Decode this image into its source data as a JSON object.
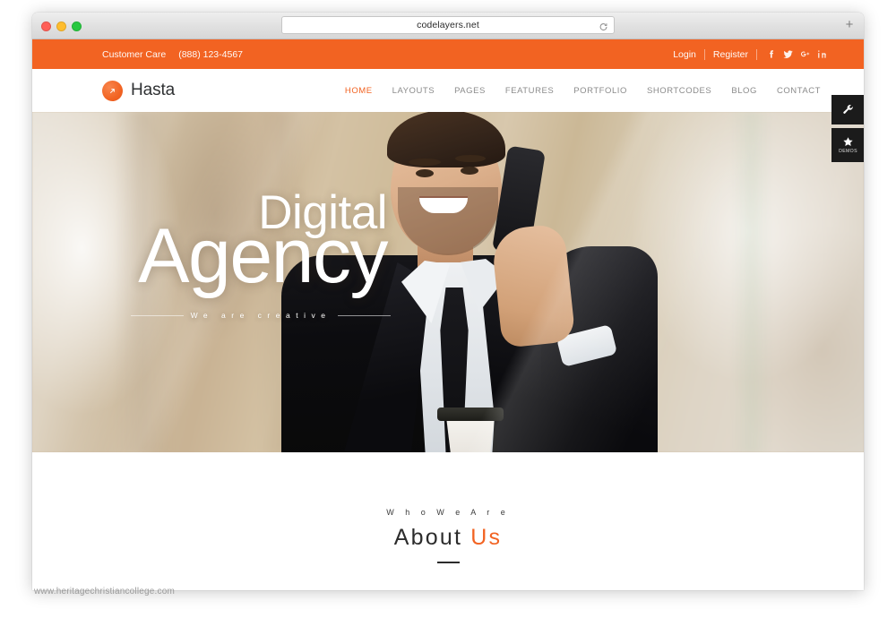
{
  "browser": {
    "url": "codelayers.net",
    "reload_icon": "reload-icon",
    "newtab_label": "+",
    "traffic_lights": [
      "close-red",
      "minimize-yellow",
      "maximize-green"
    ]
  },
  "topbar": {
    "care_label": "Customer Care",
    "phone": "(888) 123-4567",
    "login": "Login",
    "register": "Register",
    "socials": [
      {
        "name": "facebook-icon",
        "glyph": "f"
      },
      {
        "name": "twitter-icon",
        "glyph": "t"
      },
      {
        "name": "google-plus-icon",
        "glyph": "g+"
      },
      {
        "name": "linkedin-icon",
        "glyph": "in"
      }
    ]
  },
  "header": {
    "logo_text": "Hasta",
    "logo_icon": "arrow-circle-icon",
    "nav": [
      {
        "label": "HOME",
        "active": true
      },
      {
        "label": "LAYOUTS",
        "active": false
      },
      {
        "label": "PAGES",
        "active": false
      },
      {
        "label": "FEATURES",
        "active": false
      },
      {
        "label": "PORTFOLIO",
        "active": false
      },
      {
        "label": "SHORTCODES",
        "active": false
      },
      {
        "label": "BLOG",
        "active": false
      },
      {
        "label": "CONTACT",
        "active": false
      }
    ]
  },
  "sidetabs": {
    "settings_icon": "wrench-icon",
    "demos_icon": "star-icon",
    "demos_label": "DEMOS"
  },
  "hero": {
    "line1": "Digital",
    "line2": "Agency",
    "tagline": "We are creative"
  },
  "about": {
    "kicker": "W h o   W e   A r e",
    "title_dark": "About",
    "title_accent": "Us"
  },
  "watermark": "www.heritagechristiancollege.com",
  "colors": {
    "accent": "#f26322",
    "nav_text": "#8b8b8b",
    "dark": "#1b1b1b",
    "heading": "#2c2c2c"
  }
}
